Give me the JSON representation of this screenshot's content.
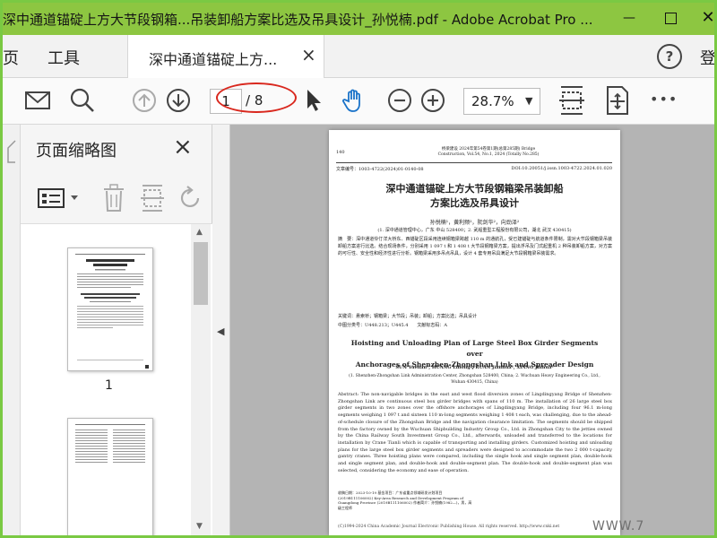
{
  "window": {
    "title": "深中通道锚碇上方大节段钢箱...吊装卸船方案比选及吊具设计_孙悦楠.pdf - Adobe Acrobat Pro ...",
    "minimize_glyph": "—",
    "close_glyph": "✕"
  },
  "menu": {
    "home": "页",
    "tools": "工具",
    "doc_tab": "深中通道锚碇上方...",
    "doc_tab_close": "×",
    "help": "?",
    "signin": "登"
  },
  "toolbar": {
    "page_current": "1",
    "page_total": "/ 8",
    "zoom": "28.7%",
    "zoom_caret": "▼",
    "more": "•••"
  },
  "thumbnails": {
    "title": "页面缩略图",
    "close": "×",
    "page_label": "1"
  },
  "page": {
    "header_num": "140",
    "header_journal": "桥梁建设 2024年第54卷第1期(总第285期) Bridge Construction, Vol.54, No.1, 2024 (Totally No.285)",
    "article_id": "文章编号：1003-4722(2024)01-0140-08",
    "doi": "DOI:10.20051/j.issn.1003-4722.2024.01.020",
    "cn_title_line1": "深中通道锚碇上方大节段钢箱梁吊装卸船",
    "cn_title_line2": "方案比选及吊具设计",
    "cn_authors": "孙悦楠¹，黄利频²，阮剑华²，向劲泽²",
    "cn_affil": "(1. 深中通道管理中心，广东 中山 528400；2. 武船重型工程股份有限公司，湖北 武汉 430415)",
    "cn_abstract": "摘　要：深中通道伶仃洋大桥东、西锚碇区段采用连续钢箱梁跨越 110 m 的通航孔，受已建锚碇与航道条件限制，需对大节段钢箱梁吊装卸船方案进行比选。结合现场条件，分别采用 1 097 t 和 1 408 t 大节段钢箱梁方案，提出浮吊及门式起重机 2 种吊装卸船方案，对方案的可行性、安全性和经济性进行分析。钢箱梁采用多吊点吊具，设计 4 套专用吊具满足大节段钢箱梁吊装需求。",
    "cn_keywords": "关键词：悬索桥；钢箱梁；大节段；吊装；卸船；方案比选；吊具设计",
    "cn_class": "中图分类号：U448.213；U445.4　　文献标志码：A",
    "en_title_line1": "Hoisting and Unloading Plan of Large Steel Box Girder Segments over",
    "en_title_line2": "Anchorages of Shenzhen-Zhongshan Link and Spreader Design",
    "en_authors": "SUN Yuenan¹, HUANG Lihong², RUAN Jianhua², XIANG Jinhua²",
    "en_affil": "(1. Shenzhen-Zhongshan Link Administration Center, Zhongshan 528400, China; 2. Wuchuan Heavy Engineering Co., Ltd., Wuhan 430415, China)",
    "en_abstract": "Abstract: The non-navigable bridges in the east and west flood diversion zones of Lingdingyang Bridge of Shenzhen-Zhongshan Link are continuous steel box girder bridges with spans of 110 m. The installation of 26 large steel box girder segments in two zones over the offshore anchorages of Lingdingyang Bridge, including four 96.1 m-long segments weighing 1 097 t and sixteen 110 m-long segments weighing 1 408 t each, was challenging, due to the ahead-of-schedule closure of the Zhongshan Bridge and the navigation clearance limitation. The segments should be shipped from the factory owned by the Wuchuan Shipbuilding Industry Group Co., Ltd. in Zhongshan City to the jetties owned by the China Railway South Investment Group Co., Ltd., afterwards, unloaded and transferred to the locations for installation by Crane Tianli which is capable of transporting and installing girders. Customized hoisting and unloading plans for the large steel box girder segments and spreaders were designed to accommodate the two 2 000 t-capacity gantry cranes. Three hoisting plans were compared, including the single hook and single segment plan, double-hook and single segment plan, and double-hook and double-segment plan. The double-hook and double-segment plan was selected, considering the economy and ease of operation.",
    "footnote": "收稿日期：2023-10-19 基金项目：广东省重点领域研发计划项目(2019B111106002) Key-Area Research and Development Program of Guangdong Province (2019B111106002) 作者简介：孙悦楠(1982—)，男，高级工程师",
    "copyright": "(C)1994-2024 China Academic Journal Electronic Publishing House. All rights reserved.    http://www.cnki.net",
    "watermark": "WWW.7"
  },
  "colors": {
    "titlebar": "#8dc641",
    "accent_blue": "#1a73c9",
    "oval_red": "#d9281e",
    "doc_bg": "#b4b4b4"
  },
  "icons": [
    "mail-icon",
    "search-icon",
    "page-up-icon",
    "page-down-icon",
    "pointer-icon",
    "hand-icon",
    "zoom-out-icon",
    "zoom-in-icon",
    "fit-width-icon",
    "fit-page-icon",
    "more-icon",
    "thumb-options-icon",
    "delete-icon",
    "extract-icon",
    "rotate-icon"
  ]
}
